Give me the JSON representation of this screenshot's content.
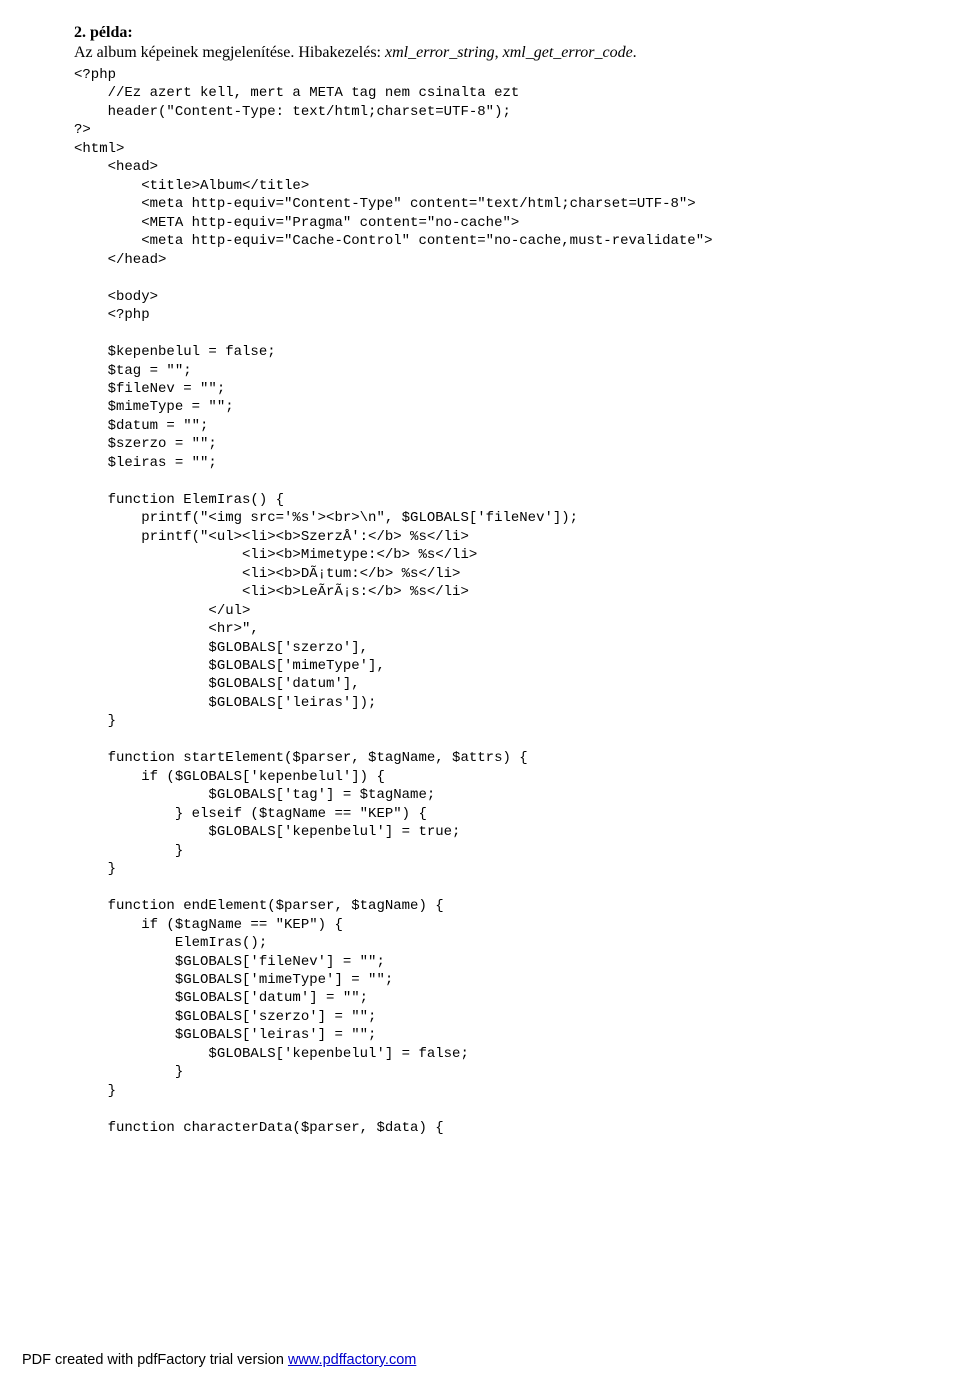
{
  "heading": "2. példa:",
  "intro_prefix": "Az album képeinek megjelenítése. Hibakezelés: ",
  "intro_em1": "xml_error_string",
  "intro_sep": ", ",
  "intro_em2": "xml_get_error_code",
  "intro_suffix": ".",
  "code": "<?php\n    //Ez azert kell, mert a META tag nem csinalta ezt\n    header(\"Content-Type: text/html;charset=UTF-8\");\n?>\n<html>\n    <head>\n        <title>Album</title>\n        <meta http-equiv=\"Content-Type\" content=\"text/html;charset=UTF-8\">\n        <META http-equiv=\"Pragma\" content=\"no-cache\">\n        <meta http-equiv=\"Cache-Control\" content=\"no-cache,must-revalidate\">\n    </head>\n\n    <body>\n    <?php\n\n    $kepenbelul = false;\n    $tag = \"\";\n    $fileNev = \"\";\n    $mimeType = \"\";\n    $datum = \"\";\n    $szerzo = \"\";\n    $leiras = \"\";\n\n    function ElemIras() {\n        printf(\"<img src='%s'><br>\\n\", $GLOBALS['fileNev']);\n        printf(\"<ul><li><b>SzerzÅ':</b> %s</li>\n                    <li><b>Mimetype:</b> %s</li>\n                    <li><b>DÃ¡tum:</b> %s</li>\n                    <li><b>LeÃ­rÃ¡s:</b> %s</li>\n                </ul>\n                <hr>\",\n                $GLOBALS['szerzo'],\n                $GLOBALS['mimeType'],\n                $GLOBALS['datum'],\n                $GLOBALS['leiras']);\n    }\n\n    function startElement($parser, $tagName, $attrs) {\n        if ($GLOBALS['kepenbelul']) {\n                $GLOBALS['tag'] = $tagName;\n            } elseif ($tagName == \"KEP\") {\n                $GLOBALS['kepenbelul'] = true;\n            }\n    }\n\n    function endElement($parser, $tagName) {\n        if ($tagName == \"KEP\") {\n            ElemIras();\n            $GLOBALS['fileNev'] = \"\";\n            $GLOBALS['mimeType'] = \"\";\n            $GLOBALS['datum'] = \"\";\n            $GLOBALS['szerzo'] = \"\";\n            $GLOBALS['leiras'] = \"\";\n                $GLOBALS['kepenbelul'] = false;\n            }\n    }\n\n    function characterData($parser, $data) {",
  "footer_text": "PDF created with pdfFactory trial version ",
  "footer_link": "www.pdffactory.com"
}
